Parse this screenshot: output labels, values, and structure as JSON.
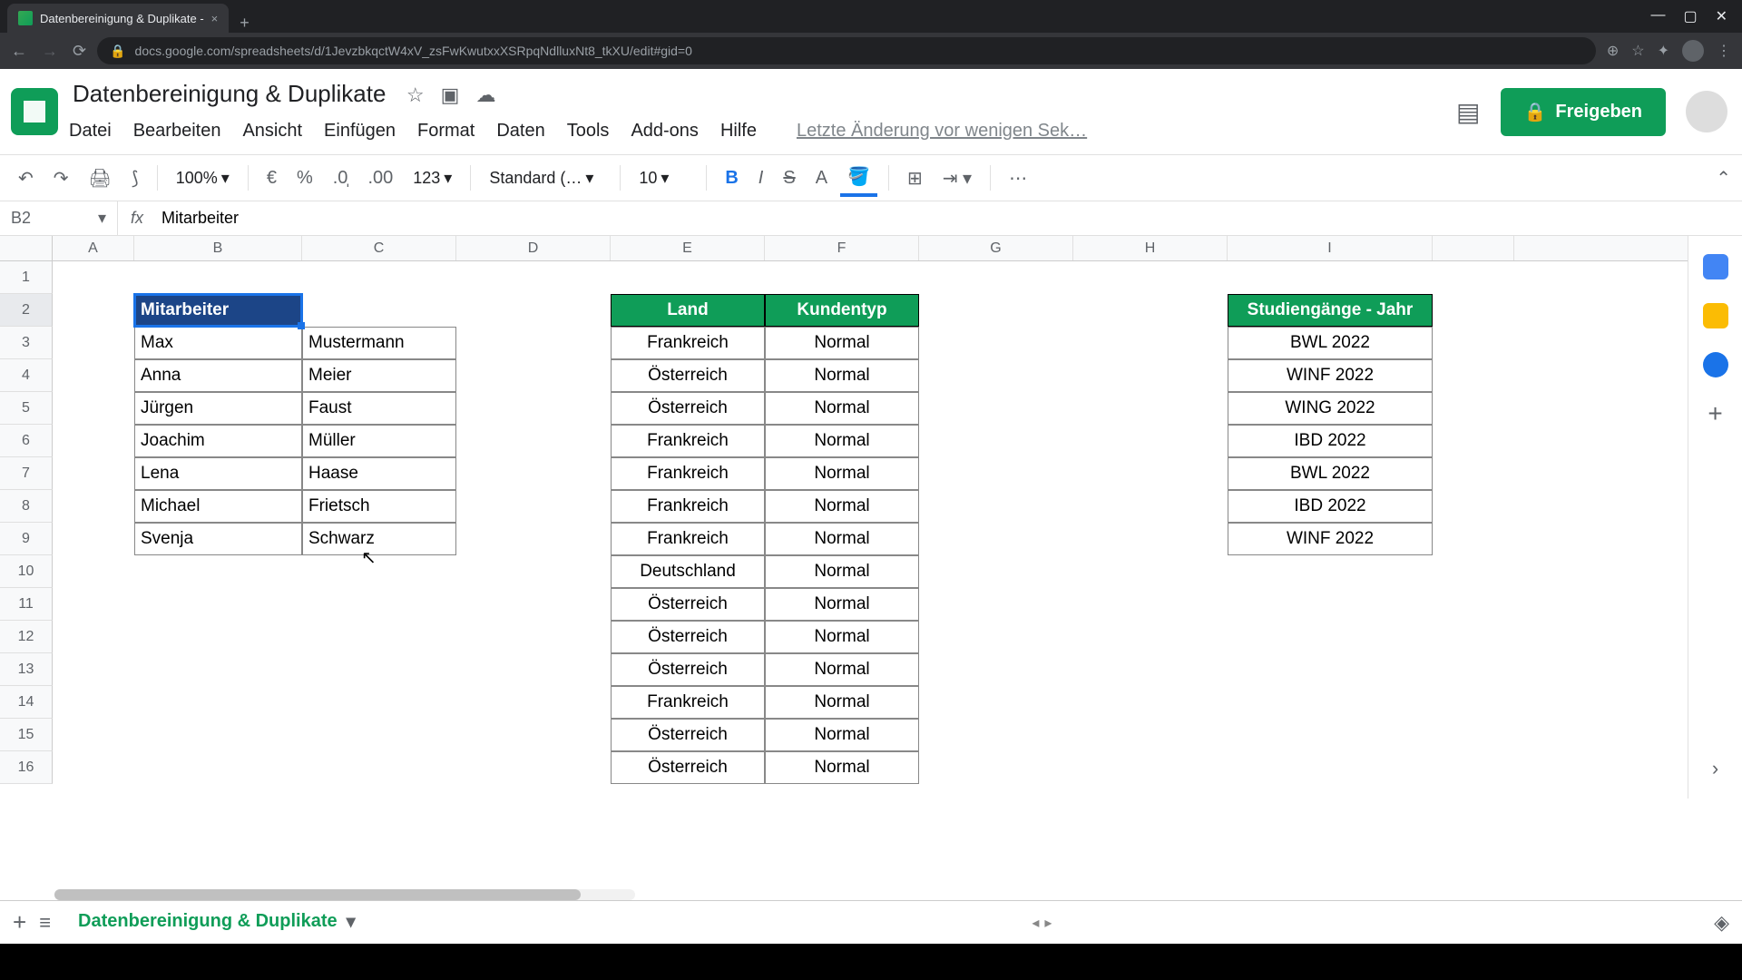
{
  "browser": {
    "tab_title": "Datenbereinigung & Duplikate - ",
    "url": "docs.google.com/spreadsheets/d/1JevzbkqctW4xV_zsFwKwutxxXSRpqNdlluxNt8_tkXU/edit#gid=0"
  },
  "doc": {
    "title": "Datenbereinigung & Duplikate",
    "last_edit": "Letzte Änderung vor wenigen Sek…",
    "share": "Freigeben"
  },
  "menus": [
    "Datei",
    "Bearbeiten",
    "Ansicht",
    "Einfügen",
    "Format",
    "Daten",
    "Tools",
    "Add-ons",
    "Hilfe"
  ],
  "toolbar": {
    "zoom": "100%",
    "format_num": "123",
    "font": "Standard (…",
    "font_size": "10"
  },
  "formula": {
    "cell_ref": "B2",
    "value": "Mitarbeiter"
  },
  "columns": [
    "A",
    "B",
    "C",
    "D",
    "E",
    "F",
    "G",
    "H",
    "I"
  ],
  "row_count": 16,
  "selected_row": 2,
  "table1": {
    "header": "Mitarbeiter",
    "rows": [
      [
        "Max",
        "Mustermann"
      ],
      [
        "Anna",
        "Meier"
      ],
      [
        "Jürgen",
        "Faust"
      ],
      [
        "Joachim",
        "Müller"
      ],
      [
        "Lena",
        "Haase"
      ],
      [
        "Michael",
        "Frietsch"
      ],
      [
        "Svenja",
        "Schwarz"
      ]
    ]
  },
  "table2": {
    "headers": [
      "Land",
      "Kundentyp"
    ],
    "rows": [
      [
        "Frankreich",
        "Normal"
      ],
      [
        "Österreich",
        "Normal"
      ],
      [
        "Österreich",
        "Normal"
      ],
      [
        "Frankreich",
        "Normal"
      ],
      [
        "Frankreich",
        "Normal"
      ],
      [
        "Frankreich",
        "Normal"
      ],
      [
        "Frankreich",
        "Normal"
      ],
      [
        "Deutschland",
        "Normal"
      ],
      [
        "Österreich",
        "Normal"
      ],
      [
        "Österreich",
        "Normal"
      ],
      [
        "Österreich",
        "Normal"
      ],
      [
        "Frankreich",
        "Normal"
      ],
      [
        "Österreich",
        "Normal"
      ],
      [
        "Österreich",
        "Normal"
      ]
    ]
  },
  "table3": {
    "header": "Studiengänge - Jahr",
    "rows": [
      "BWL 2022",
      "WINF 2022",
      "WING 2022",
      "IBD 2022",
      "BWL 2022",
      "IBD 2022",
      "WINF 2022"
    ]
  },
  "sheet_tab": "Datenbereinigung & Duplikate"
}
